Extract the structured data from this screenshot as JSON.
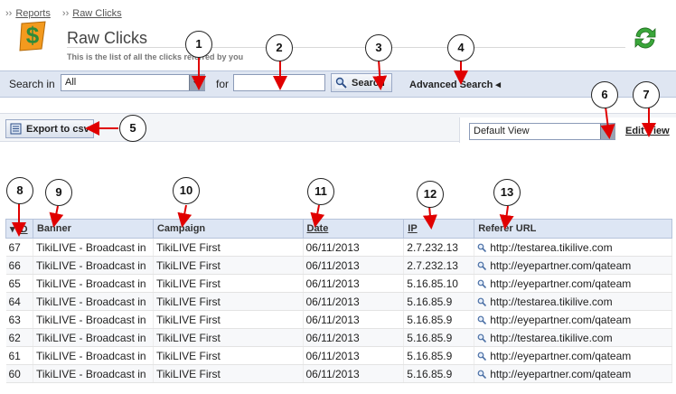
{
  "breadcrumb": [
    {
      "label": "Reports"
    },
    {
      "label": "Raw Clicks"
    }
  ],
  "header": {
    "title": "Raw Clicks",
    "subtitle": "This is the list of all the clicks referred by you"
  },
  "search": {
    "label": "Search in",
    "selected": "All",
    "for_label": "for",
    "query_value": "",
    "button_label": "Search",
    "advanced_label": "Advanced Search",
    "advanced_arrow": "◂"
  },
  "toolbar": {
    "export_label": "Export to csv",
    "view_selected": "Default View",
    "edit_view_label": "Edit View"
  },
  "table": {
    "sort_indicator": "▾",
    "headers": [
      "ID",
      "Banner",
      "Campaign",
      "Date",
      "IP",
      "Referer URL"
    ],
    "rows": [
      [
        "67",
        "TikiLIVE - Broadcast in",
        "TikiLIVE First",
        "06/11/2013",
        "2.7.232.13",
        "http://testarea.tikilive.com"
      ],
      [
        "66",
        "TikiLIVE - Broadcast in",
        "TikiLIVE First",
        "06/11/2013",
        "2.7.232.13",
        "http://eyepartner.com/qateam"
      ],
      [
        "65",
        "TikiLIVE - Broadcast in",
        "TikiLIVE First",
        "06/11/2013",
        "5.16.85.10",
        "http://eyepartner.com/qateam"
      ],
      [
        "64",
        "TikiLIVE - Broadcast in",
        "TikiLIVE First",
        "06/11/2013",
        "5.16.85.9",
        "http://testarea.tikilive.com"
      ],
      [
        "63",
        "TikiLIVE - Broadcast in",
        "TikiLIVE First",
        "06/11/2013",
        "5.16.85.9",
        "http://eyepartner.com/qateam"
      ],
      [
        "62",
        "TikiLIVE - Broadcast in",
        "TikiLIVE First",
        "06/11/2013",
        "5.16.85.9",
        "http://testarea.tikilive.com"
      ],
      [
        "61",
        "TikiLIVE - Broadcast in",
        "TikiLIVE First",
        "06/11/2013",
        "5.16.85.9",
        "http://eyepartner.com/qateam"
      ],
      [
        "60",
        "TikiLIVE - Broadcast in",
        "TikiLIVE First",
        "06/11/2013",
        "5.16.85.9",
        "http://eyepartner.com/qateam"
      ]
    ]
  },
  "callouts": [
    "1",
    "2",
    "3",
    "4",
    "5",
    "6",
    "7",
    "8",
    "9",
    "10",
    "11",
    "12",
    "13"
  ],
  "colors": {
    "toolbar_bg": "#dfe6f2",
    "header_bg": "#dde6f4",
    "arrow": "#e00000",
    "logo_orange": "#f39a1e",
    "refresh_green": "#3aa63a"
  },
  "icons": {
    "logo": "dollar-logo-icon",
    "refresh": "refresh-icon",
    "search": "magnifier-icon",
    "export": "csv-icon"
  }
}
